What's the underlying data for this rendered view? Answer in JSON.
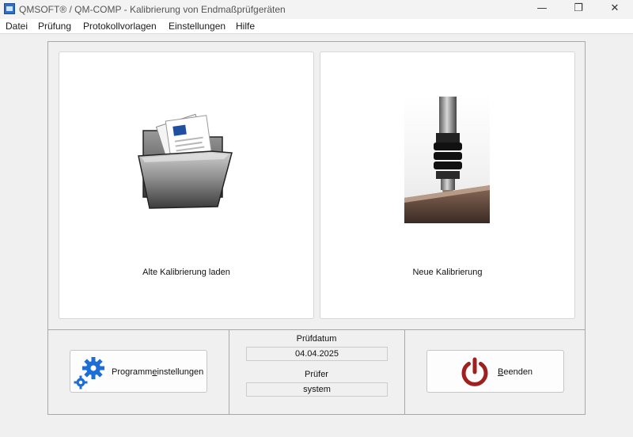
{
  "window": {
    "title": "QMSOFT® / QM-COMP - Kalibrierung von Endmaßprüfgeräten",
    "minimize_glyph": "—",
    "maximize_glyph": "❐",
    "close_glyph": "✕"
  },
  "menu": {
    "items": [
      "Datei",
      "Prüfung",
      "Protokollvorlagen",
      "Einstellungen",
      "Hilfe"
    ]
  },
  "cards": {
    "load": {
      "label": "Alte Kalibrierung laden",
      "icon": "open-folder-icon"
    },
    "new": {
      "label": "Neue Kalibrierung",
      "icon": "measuring-probe-image"
    }
  },
  "settings_button": {
    "label_pre": "Programm",
    "label_mnemonic": "e",
    "label_post": "instellungen",
    "icon": "gear-icon"
  },
  "quit_button": {
    "label_mnemonic": "B",
    "label_post": "eenden",
    "icon": "power-icon",
    "icon_color": "#a02020"
  },
  "info": {
    "date_label": "Prüfdatum",
    "date_value": "04.04.2025",
    "tester_label": "Prüfer",
    "tester_value": "system"
  },
  "colors": {
    "gear": "#1d6fd6",
    "power": "#a02020"
  }
}
